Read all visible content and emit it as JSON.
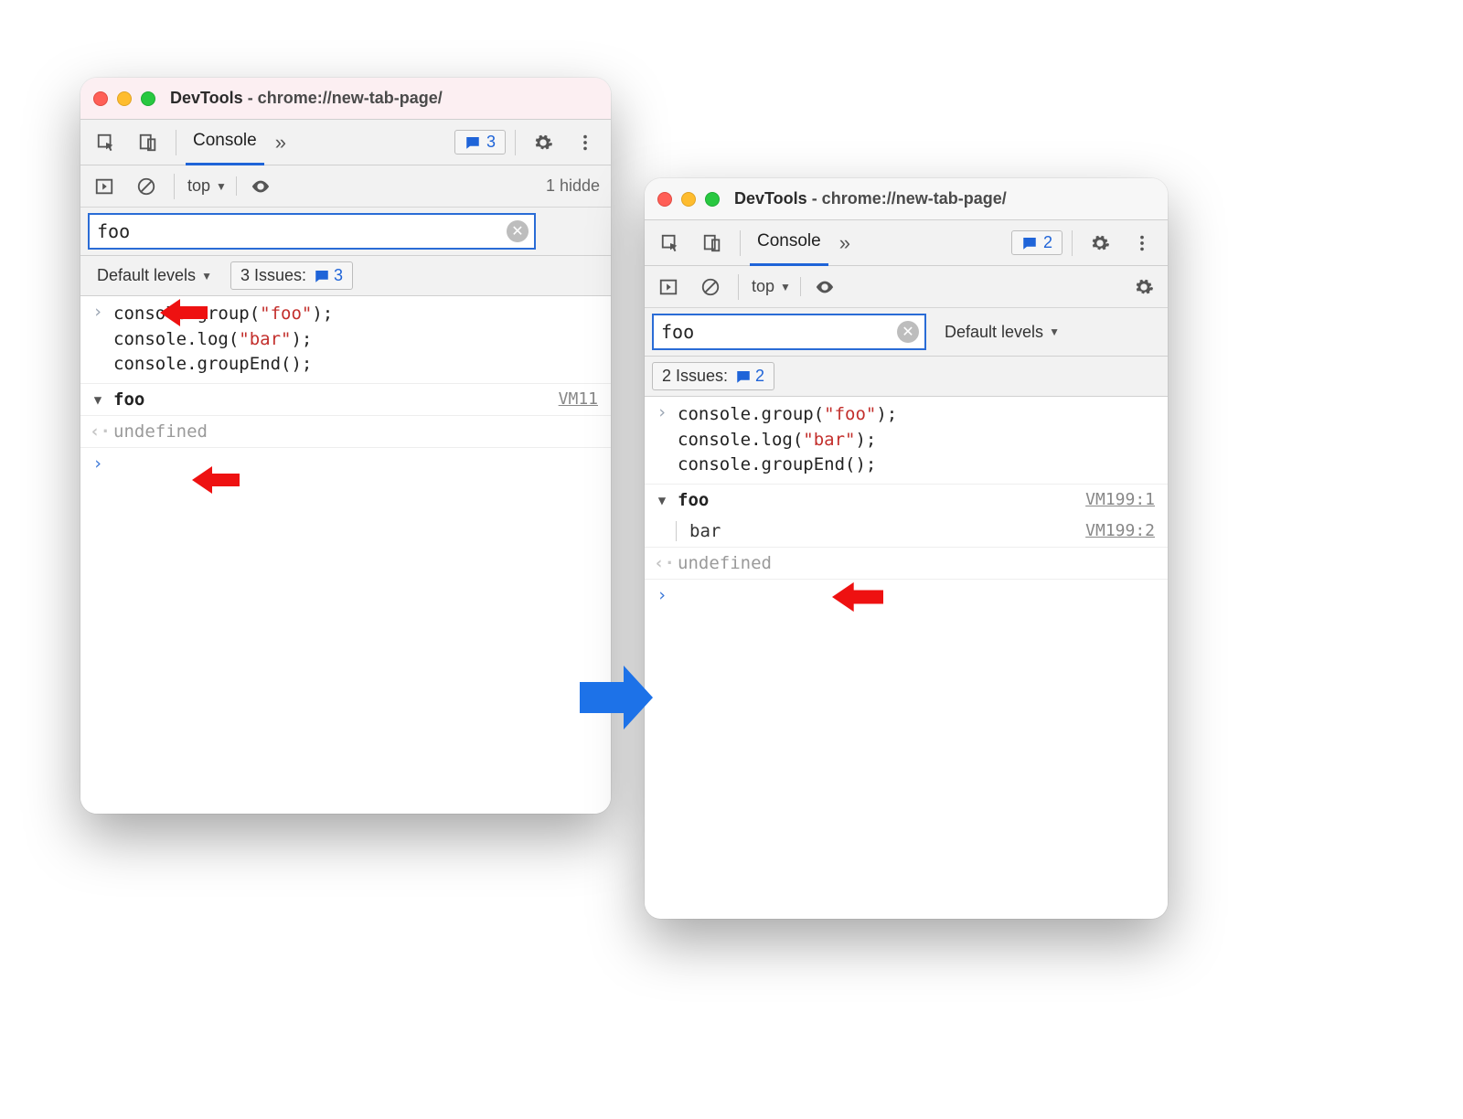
{
  "common": {
    "title_prefix": "DevTools",
    "title_url": " - chrome://new-tab-page/",
    "tab_console": "Console",
    "context": "top",
    "filter_value": "foo",
    "levels_label": "Default levels",
    "src_prefix": "VM",
    "code_line1_a": "console.group(",
    "code_line1_str": "\"foo\"",
    "code_line1_b": ");",
    "code_line2_a": "console.log(",
    "code_line2_str": "\"bar\"",
    "code_line2_b": ");",
    "code_line3": "console.groupEnd();",
    "group_name": "foo",
    "bar_text": "bar",
    "undefined_text": "undefined"
  },
  "left": {
    "issue_badge": "3",
    "hidden_text": "1 hidde",
    "issues_label": "3 Issues:",
    "issues_count": "3",
    "src_partial": "VM11"
  },
  "right": {
    "issue_badge": "2",
    "issues_label": "2 Issues:",
    "issues_count": "2",
    "src_line1": "VM199:1",
    "src_line2": "VM199:2"
  }
}
